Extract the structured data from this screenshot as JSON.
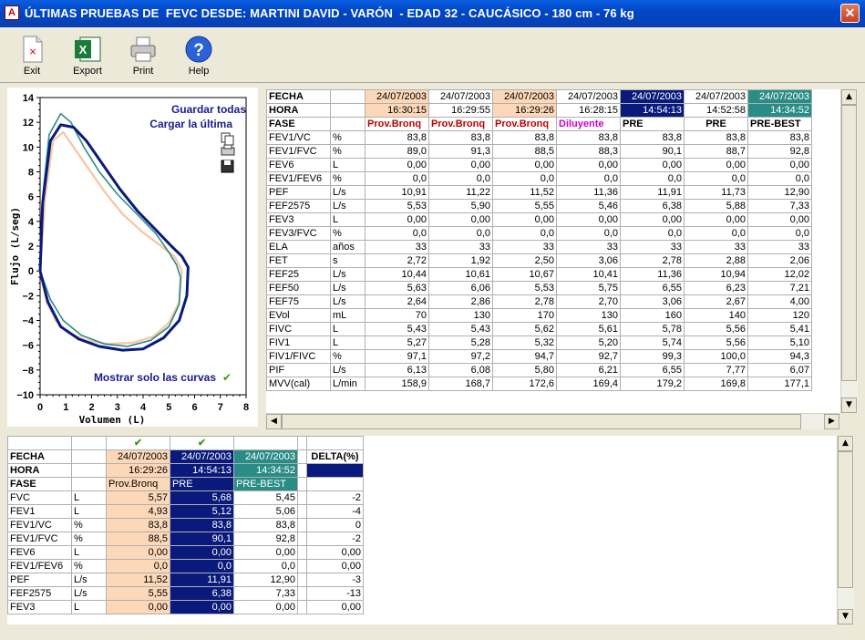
{
  "window": {
    "title": "ÚLTIMAS PRUEBAS DE  FEVC DESDE: MARTINI DAVID - VARÓN  - EDAD 32 - CAUCÁSICO - 180 cm - 76 kg",
    "icon": "app-icon",
    "close_icon": "close-icon"
  },
  "toolbar": {
    "exit": "Exit",
    "export": "Export",
    "print": "Print",
    "help": "Help"
  },
  "graph": {
    "save_all": "Guardar todas",
    "load_last": "Cargar la última",
    "show_only": "Mostrar solo las curvas",
    "ylabel": "Flujo (L/seg)",
    "xlabel": "Volumen (L)",
    "yticks": [
      "14",
      "12",
      "10",
      "8",
      "6",
      "4",
      "2",
      "0",
      "−2",
      "−4",
      "−6",
      "−8",
      "−10"
    ],
    "xticks": [
      "0",
      "1",
      "2",
      "3",
      "4",
      "5",
      "6",
      "7",
      "8"
    ],
    "colors": {
      "peach": "#f6c9a6",
      "navy": "#0a1a7c",
      "teal": "#2a8c86"
    }
  },
  "top_table": {
    "row_labels": {
      "fecha": "FECHA",
      "hora": "HORA",
      "fase": "FASE"
    },
    "columns": [
      {
        "fecha": "24/07/2003",
        "hora": "16:30:15",
        "fase": "Prov.Bronq",
        "style": "peach",
        "fase_color": "#c00000"
      },
      {
        "fecha": "24/07/2003",
        "hora": "16:29:55",
        "fase": "Prov.Bronq",
        "style": "plain",
        "fase_color": "#c00000"
      },
      {
        "fecha": "24/07/2003",
        "hora": "16:29:26",
        "fase": "Prov.Bronq",
        "style": "peach",
        "fase_color": "#c00000"
      },
      {
        "fecha": "24/07/2003",
        "hora": "16:28:15",
        "fase": "Diluyente",
        "style": "plain",
        "fase_color": "#d000d0"
      },
      {
        "fecha": "24/07/2003",
        "hora": "14:54:13",
        "fase": "PRE",
        "style": "navy",
        "fase_color": "#000000"
      },
      {
        "fecha": "24/07/2003",
        "hora": "14:52:58",
        "fase": "PRE",
        "style": "plain",
        "fase_color": "#000000"
      },
      {
        "fecha": "24/07/2003",
        "hora": "14:34:52",
        "fase": "PRE-BEST",
        "style": "teal",
        "fase_color": "#000000"
      }
    ],
    "rows": [
      {
        "name": "FEV1/VC",
        "unit": "%",
        "values": [
          "83,8",
          "83,8",
          "83,8",
          "83,8",
          "83,8",
          "83,8",
          "83,8"
        ]
      },
      {
        "name": "FEV1/FVC",
        "unit": "%",
        "values": [
          "89,0",
          "91,3",
          "88,5",
          "88,3",
          "90,1",
          "88,7",
          "92,8"
        ]
      },
      {
        "name": "FEV6",
        "unit": "L",
        "values": [
          "0,00",
          "0,00",
          "0,00",
          "0,00",
          "0,00",
          "0,00",
          "0,00"
        ]
      },
      {
        "name": "FEV1/FEV6",
        "unit": "%",
        "values": [
          "0,0",
          "0,0",
          "0,0",
          "0,0",
          "0,0",
          "0,0",
          "0,0"
        ]
      },
      {
        "name": "PEF",
        "unit": "L/s",
        "values": [
          "10,91",
          "11,22",
          "11,52",
          "11,36",
          "11,91",
          "11,73",
          "12,90"
        ]
      },
      {
        "name": "FEF2575",
        "unit": "L/s",
        "values": [
          "5,53",
          "5,90",
          "5,55",
          "5,46",
          "6,38",
          "5,88",
          "7,33"
        ]
      },
      {
        "name": "FEV3",
        "unit": "L",
        "values": [
          "0,00",
          "0,00",
          "0,00",
          "0,00",
          "0,00",
          "0,00",
          "0,00"
        ]
      },
      {
        "name": "FEV3/FVC",
        "unit": "%",
        "values": [
          "0,0",
          "0,0",
          "0,0",
          "0,0",
          "0,0",
          "0,0",
          "0,0"
        ]
      },
      {
        "name": "ELA",
        "unit": "años",
        "values": [
          "33",
          "33",
          "33",
          "33",
          "33",
          "33",
          "33"
        ]
      },
      {
        "name": "FET",
        "unit": "s",
        "values": [
          "2,72",
          "1,92",
          "2,50",
          "3,06",
          "2,78",
          "2,88",
          "2,06"
        ]
      },
      {
        "name": "FEF25",
        "unit": "L/s",
        "values": [
          "10,44",
          "10,61",
          "10,67",
          "10,41",
          "11,36",
          "10,94",
          "12,02"
        ]
      },
      {
        "name": "FEF50",
        "unit": "L/s",
        "values": [
          "5,63",
          "6,06",
          "5,53",
          "5,75",
          "6,55",
          "6,23",
          "7,21"
        ]
      },
      {
        "name": "FEF75",
        "unit": "L/s",
        "values": [
          "2,64",
          "2,86",
          "2,78",
          "2,70",
          "3,06",
          "2,67",
          "4,00"
        ]
      },
      {
        "name": "EVol",
        "unit": "mL",
        "values": [
          "70",
          "130",
          "170",
          "130",
          "160",
          "140",
          "120"
        ]
      },
      {
        "name": "FIVC",
        "unit": "L",
        "values": [
          "5,43",
          "5,43",
          "5,62",
          "5,61",
          "5,78",
          "5,56",
          "5,41"
        ]
      },
      {
        "name": "FIV1",
        "unit": "L",
        "values": [
          "5,27",
          "5,28",
          "5,32",
          "5,20",
          "5,74",
          "5,56",
          "5,10"
        ]
      },
      {
        "name": "FIV1/FIVC",
        "unit": "%",
        "values": [
          "97,1",
          "97,2",
          "94,7",
          "92,7",
          "99,3",
          "100,0",
          "94,3"
        ]
      },
      {
        "name": "PIF",
        "unit": "L/s",
        "values": [
          "6,13",
          "6,08",
          "5,80",
          "6,21",
          "6,55",
          "7,77",
          "6,07"
        ]
      },
      {
        "name": "MVV(cal)",
        "unit": "L/min",
        "values": [
          "158,9",
          "168,7",
          "172,6",
          "169,4",
          "179,2",
          "169,8",
          "177,1"
        ]
      }
    ]
  },
  "bottom_table": {
    "row_labels": {
      "fecha": "FECHA",
      "hora": "HORA",
      "fase": "FASE"
    },
    "delta_label": "DELTA(%)",
    "check_icon": "check-icon",
    "columns": [
      {
        "fecha": "24/07/2003",
        "hora": "16:29:26",
        "fase": "Prov.Bronq",
        "style": "peach",
        "checked": true
      },
      {
        "fecha": "24/07/2003",
        "hora": "14:54:13",
        "fase": "PRE",
        "style": "navy",
        "checked": true
      },
      {
        "fecha": "24/07/2003",
        "hora": "14:34:52",
        "fase": "PRE-BEST",
        "style": "teal",
        "checked": false
      }
    ],
    "rows": [
      {
        "name": "FVC",
        "unit": "L",
        "values": [
          "5,57",
          "5,68",
          "5,45"
        ],
        "delta": "-2"
      },
      {
        "name": "FEV1",
        "unit": "L",
        "values": [
          "4,93",
          "5,12",
          "5,06"
        ],
        "delta": "-4"
      },
      {
        "name": "FEV1/VC",
        "unit": "%",
        "values": [
          "83,8",
          "83,8",
          "83,8"
        ],
        "delta": "0"
      },
      {
        "name": "FEV1/FVC",
        "unit": "%",
        "values": [
          "88,5",
          "90,1",
          "92,8"
        ],
        "delta": "-2"
      },
      {
        "name": "FEV6",
        "unit": "L",
        "values": [
          "0,00",
          "0,00",
          "0,00"
        ],
        "delta": "0,00"
      },
      {
        "name": "FEV1/FEV6",
        "unit": "%",
        "values": [
          "0,0",
          "0,0",
          "0,0"
        ],
        "delta": "0,00"
      },
      {
        "name": "PEF",
        "unit": "L/s",
        "values": [
          "11,52",
          "11,91",
          "12,90"
        ],
        "delta": "-3"
      },
      {
        "name": "FEF2575",
        "unit": "L/s",
        "values": [
          "5,55",
          "6,38",
          "7,33"
        ],
        "delta": "-13"
      },
      {
        "name": "FEV3",
        "unit": "L",
        "values": [
          "0,00",
          "0,00",
          "0,00"
        ],
        "delta": "0,00"
      }
    ]
  }
}
